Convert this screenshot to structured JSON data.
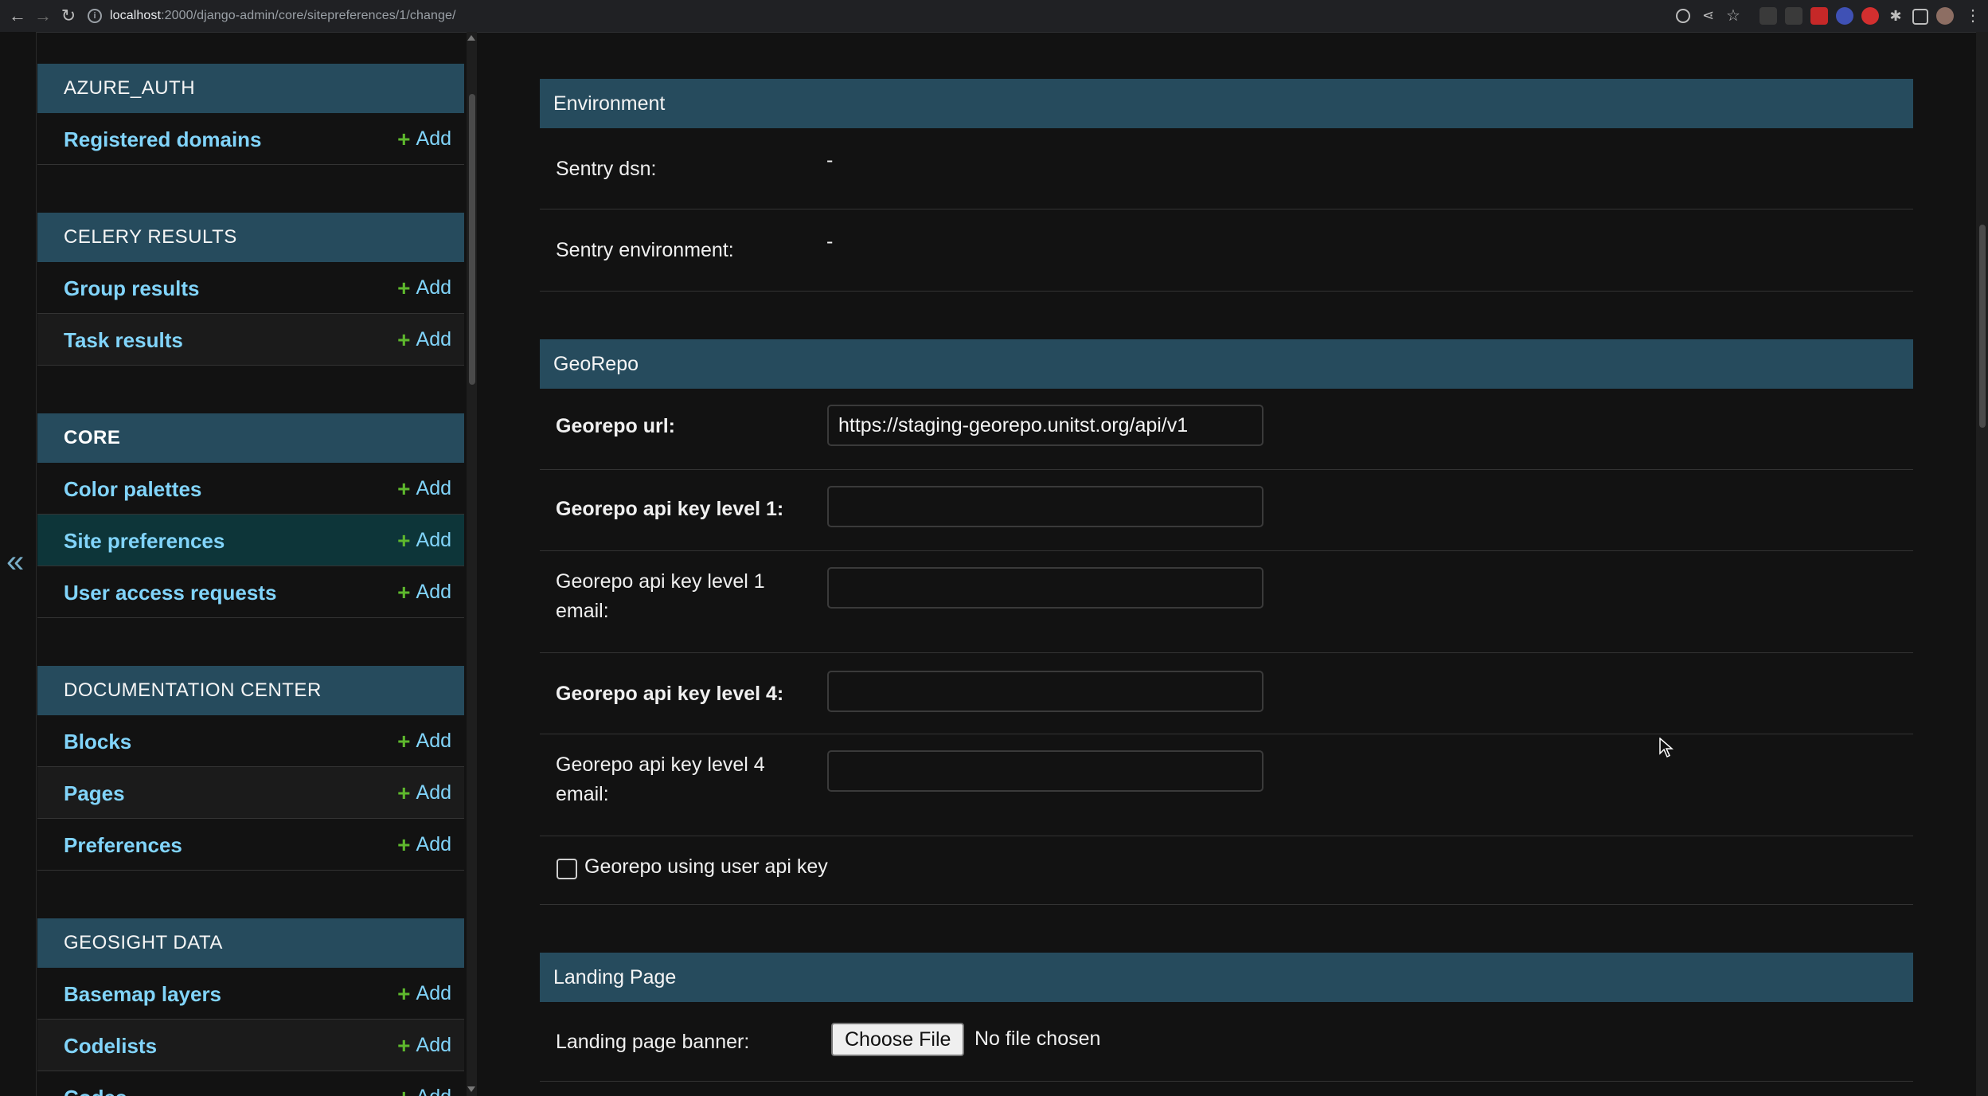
{
  "browser": {
    "url_host": "localhost",
    "url_rest": ":2000/django-admin/core/sitepreferences/1/change/"
  },
  "sidebar": {
    "collapse_glyph": "«",
    "add_label": "Add",
    "modules": [
      {
        "caption": "AZURE_AUTH",
        "items": [
          {
            "label": "Registered domains"
          }
        ]
      },
      {
        "caption": "CELERY RESULTS",
        "items": [
          {
            "label": "Group results"
          },
          {
            "label": "Task results"
          }
        ]
      },
      {
        "caption": "CORE",
        "items": [
          {
            "label": "Color palettes"
          },
          {
            "label": "Site preferences",
            "active": true
          },
          {
            "label": "User access requests"
          }
        ]
      },
      {
        "caption": "DOCUMENTATION CENTER",
        "items": [
          {
            "label": "Blocks"
          },
          {
            "label": "Pages"
          },
          {
            "label": "Preferences"
          }
        ]
      },
      {
        "caption": "GEOSIGHT DATA",
        "items": [
          {
            "label": "Basemap layers"
          },
          {
            "label": "Codelists"
          },
          {
            "label": "Codes"
          }
        ]
      }
    ]
  },
  "main": {
    "environment": {
      "title": "Environment",
      "sentry_dsn_label": "Sentry dsn:",
      "sentry_dsn_value": "-",
      "sentry_env_label": "Sentry environment:",
      "sentry_env_value": "-"
    },
    "georepo": {
      "title": "GeoRepo",
      "url_label": "Georepo url:",
      "url_value": "https://staging-georepo.unitst.org/api/v1",
      "key1_label": "Georepo api key level 1:",
      "key1_value": "",
      "key1_email_label": "Georepo api key level 1 email:",
      "key1_email_value": "",
      "key4_label": "Georepo api key level 4:",
      "key4_value": "",
      "key4_email_label": "Georepo api key level 4 email:",
      "key4_email_value": "",
      "user_key_label": "Georepo using user api key",
      "user_key_checked": false
    },
    "landing": {
      "title": "Landing Page",
      "banner_label": "Landing page banner:",
      "choose_file_label": "Choose File",
      "file_status": "No file chosen"
    }
  },
  "colors": {
    "header_bg": "#264b5d",
    "link": "#81d4fa",
    "add_icon": "#5eb82d",
    "active_row": "#0d3539"
  }
}
